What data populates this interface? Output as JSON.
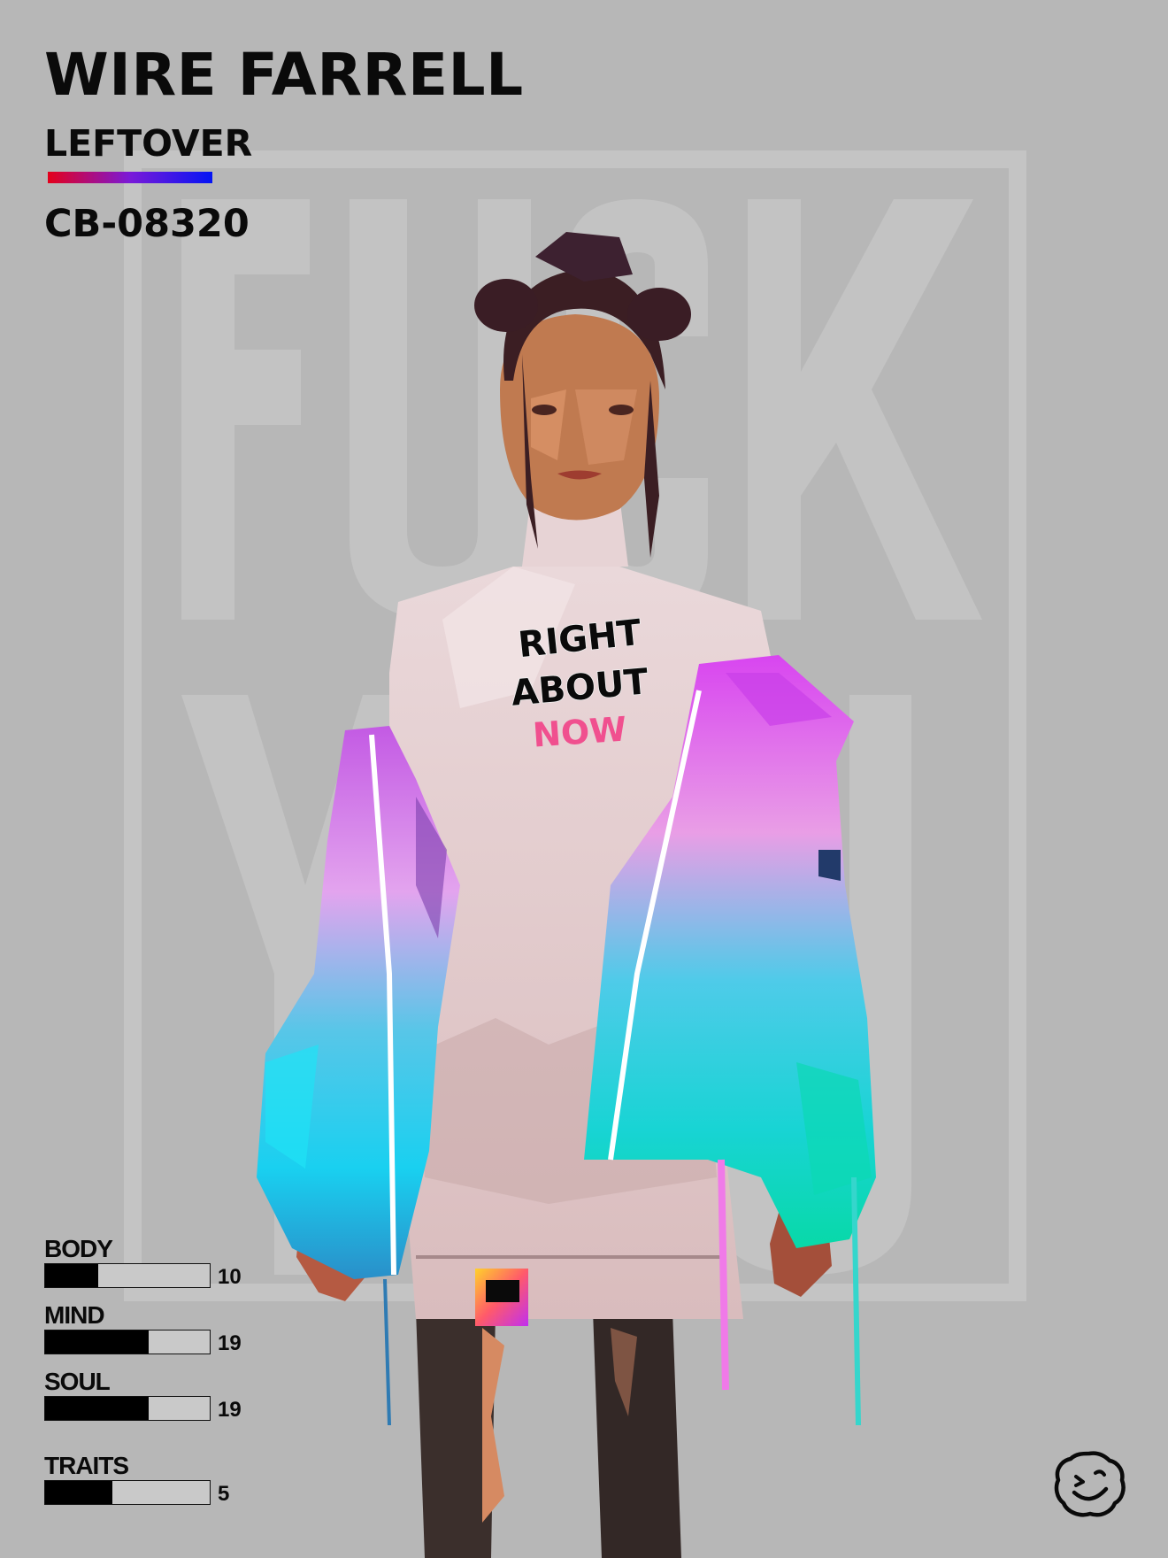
{
  "card": {
    "name": "WIRE FARRELL",
    "faction": "LEFTOVER",
    "serial": "CB-08320",
    "gradient_colors": [
      "#e4001b",
      "#7a1ad8",
      "#0414f4"
    ]
  },
  "shirt_text": {
    "line1": "RIGHT",
    "line2": "ABOUT",
    "line3": "NOW",
    "accent_color": "#f0508f"
  },
  "stats": {
    "body": {
      "label": "BODY",
      "value": "10",
      "fill_fraction": 0.32
    },
    "mind": {
      "label": "MIND",
      "value": "19",
      "fill_fraction": 0.63
    },
    "soul": {
      "label": "SOUL",
      "value": "19",
      "fill_fraction": 0.63
    },
    "traits": {
      "label": "TRAITS",
      "value": "5",
      "fill_fraction": 0.41
    }
  },
  "icons": {
    "logo": "smiley-face-logo-icon"
  }
}
